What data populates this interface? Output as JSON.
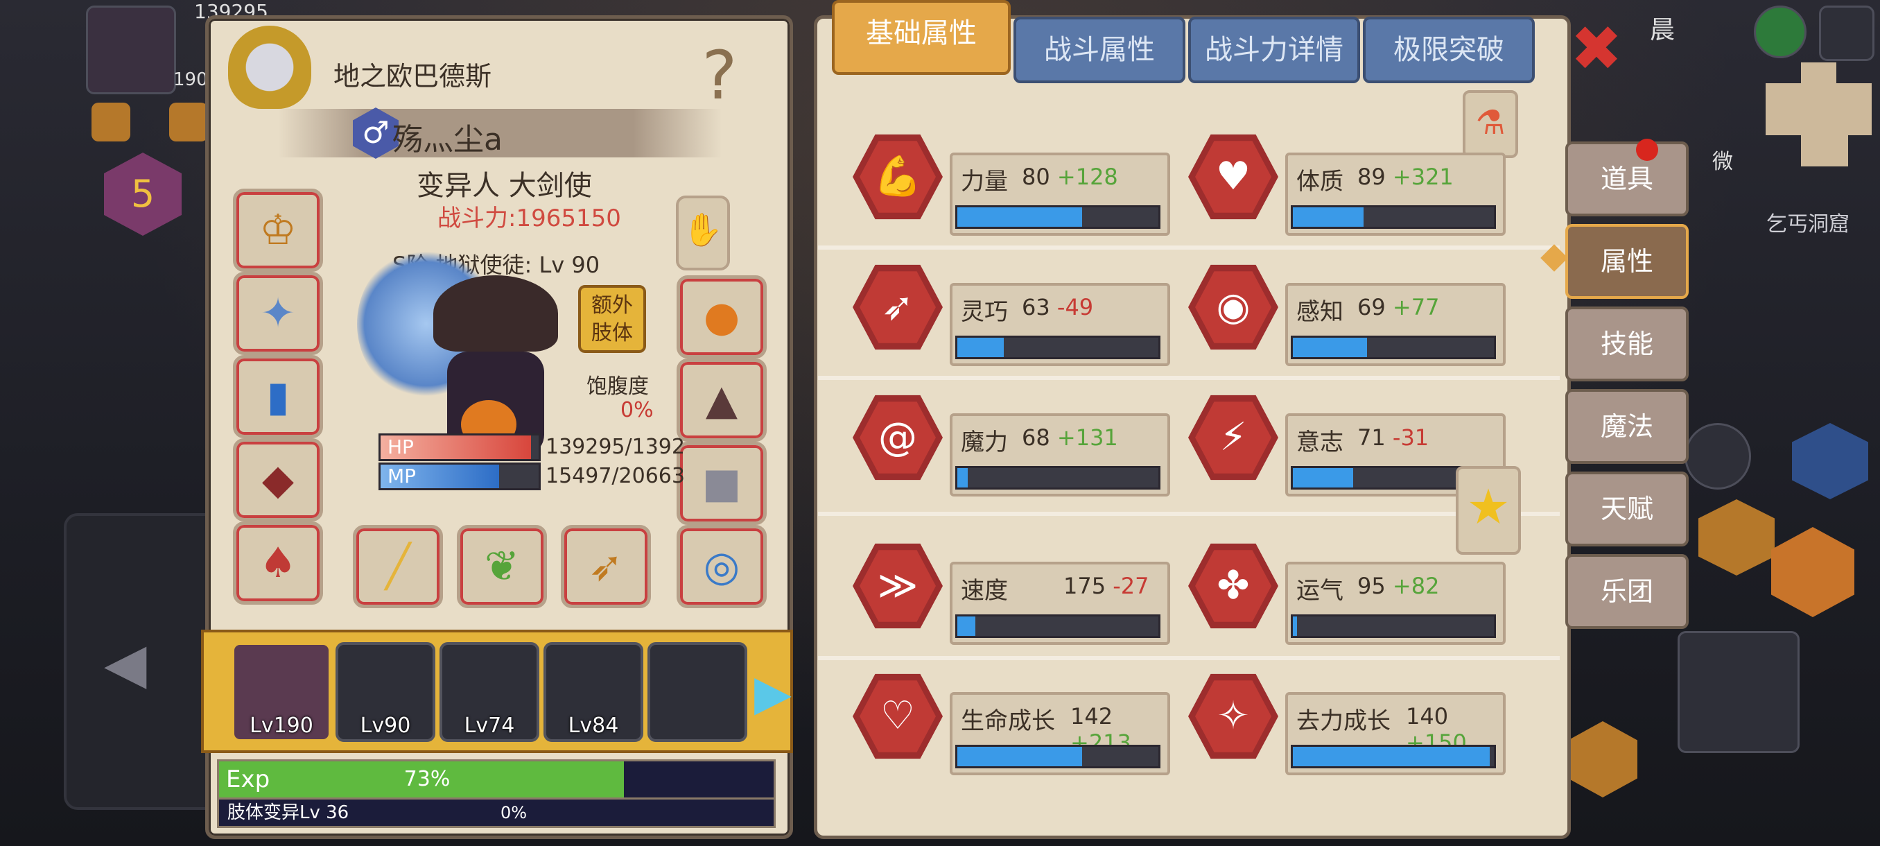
{
  "character": {
    "title": "地之欧巴德斯",
    "player_name": "殇灬尘a",
    "class": "变异人 大剑使",
    "power": "战斗力:1965150",
    "tier": "S阶 地狱使徒: Lv 90",
    "extra_limb_button": "额外\n肢体",
    "satiety_label": "饱腹度",
    "satiety_value": "0%",
    "hp_label": "HP",
    "hp_value": "139295/1392",
    "hp_ratio": 0.95,
    "mp_label": "MP",
    "mp_value": "15497/20663",
    "mp_ratio": 0.75
  },
  "party": [
    {
      "level": "Lv190"
    },
    {
      "level": "Lv90"
    },
    {
      "level": "Lv74"
    },
    {
      "level": "Lv84"
    },
    {
      "level": ""
    }
  ],
  "exp": {
    "label": "Exp",
    "percent_text": "73%",
    "ratio": 0.73
  },
  "limb": {
    "label": "肢体变异Lv 36",
    "percent_text": "0%"
  },
  "tabs": [
    {
      "label": "基础属性",
      "active": true
    },
    {
      "label": "战斗属性",
      "active": false
    },
    {
      "label": "战斗力详情",
      "active": false
    },
    {
      "label": "极限突破",
      "active": false
    }
  ],
  "stats": [
    {
      "name": "力量",
      "base": "80",
      "bonus": "+128",
      "sign": "pos",
      "ratio": 0.62,
      "icon": "muscle-icon"
    },
    {
      "name": "体质",
      "base": "89",
      "bonus": "+321",
      "sign": "pos",
      "ratio": 0.35,
      "icon": "strongman-icon"
    },
    {
      "name": "灵巧",
      "base": "63",
      "bonus": "-49",
      "sign": "neg",
      "ratio": 0.23,
      "icon": "running-icon"
    },
    {
      "name": "感知",
      "base": "69",
      "bonus": "+77",
      "sign": "pos",
      "ratio": 0.37,
      "icon": "eye-icon"
    },
    {
      "name": "魔力",
      "base": "68",
      "bonus": "+131",
      "sign": "pos",
      "ratio": 0.05,
      "icon": "spiral-icon"
    },
    {
      "name": "意志",
      "base": "71",
      "bonus": "-31",
      "sign": "neg",
      "ratio": 0.3,
      "icon": "head-bolt-icon"
    },
    {
      "name": "速度",
      "base": "175",
      "bonus": "-27",
      "sign": "neg",
      "ratio": 0.09,
      "icon": "wing-icon"
    },
    {
      "name": "运气",
      "base": "95",
      "bonus": "+82",
      "sign": "pos",
      "ratio": 0.02,
      "icon": "clover-icon"
    },
    {
      "name": "生命成长",
      "base": "142",
      "bonus": "+213",
      "sign": "pos",
      "ratio": 0.62,
      "icon": "heart-icon"
    },
    {
      "name": "去力成长",
      "base": "140",
      "bonus": "+150",
      "sign": "pos",
      "ratio": 0.98,
      "icon": "rune-icon"
    }
  ],
  "side_menu": [
    {
      "label": "道具",
      "active": false
    },
    {
      "label": "属性",
      "active": true
    },
    {
      "label": "技能",
      "active": false
    },
    {
      "label": "魔法",
      "active": false
    },
    {
      "label": "天赋",
      "active": false
    },
    {
      "label": "乐团",
      "active": false
    }
  ],
  "hud": {
    "level_badge": "5",
    "location": "乞丐洞窟",
    "close_symbol": "✖",
    "top_left_hp": "139295",
    "top_left_lv": "190",
    "micro_label": "微",
    "top_label": "晨"
  },
  "colors": {
    "accent_gold": "#e5a84a",
    "stat_bar_blue": "#3a9ae8",
    "positive": "#56a43a",
    "negative": "#c73b34"
  }
}
